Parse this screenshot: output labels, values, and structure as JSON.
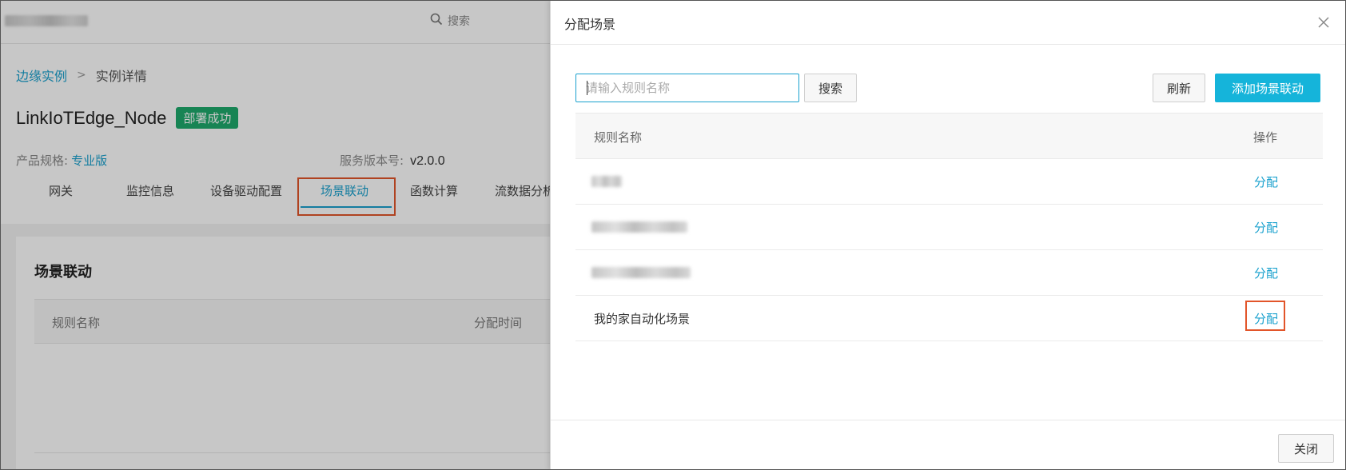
{
  "header": {
    "search_label": "搜索"
  },
  "breadcrumb": {
    "parent": "边缘实例",
    "separator": ">",
    "current": "实例详情"
  },
  "instance": {
    "name": "LinkIoTEdge_Node",
    "status": "部署成功",
    "spec_label": "产品规格:",
    "spec_value": "专业版",
    "version_label": "服务版本号:",
    "version_value": "v2.0.0"
  },
  "tabs": [
    {
      "label": "网关"
    },
    {
      "label": "监控信息"
    },
    {
      "label": "设备驱动配置"
    },
    {
      "label": "场景联动",
      "active": true
    },
    {
      "label": "函数计算"
    },
    {
      "label": "流数据分析"
    }
  ],
  "section": {
    "title": "场景联动",
    "columns": [
      "规则名称",
      "分配时间"
    ]
  },
  "drawer": {
    "title": "分配场景",
    "search_placeholder": "请输入规则名称",
    "search_button": "搜索",
    "refresh_button": "刷新",
    "add_button": "添加场景联动",
    "columns": {
      "name": "规则名称",
      "action": "操作"
    },
    "rows": [
      {
        "name": "",
        "blurred": true,
        "action": "分配"
      },
      {
        "name": "",
        "blurred": true,
        "action": "分配"
      },
      {
        "name": "",
        "blurred": true,
        "action": "分配"
      },
      {
        "name": "我的家自动化场景",
        "blurred": false,
        "action": "分配",
        "highlighted": true
      }
    ],
    "close_button": "关闭"
  },
  "colors": {
    "accent": "#1aa1ce",
    "primary_button": "#15b4da",
    "success_badge": "#1eaa6c",
    "highlight_box": "#e2552a"
  }
}
